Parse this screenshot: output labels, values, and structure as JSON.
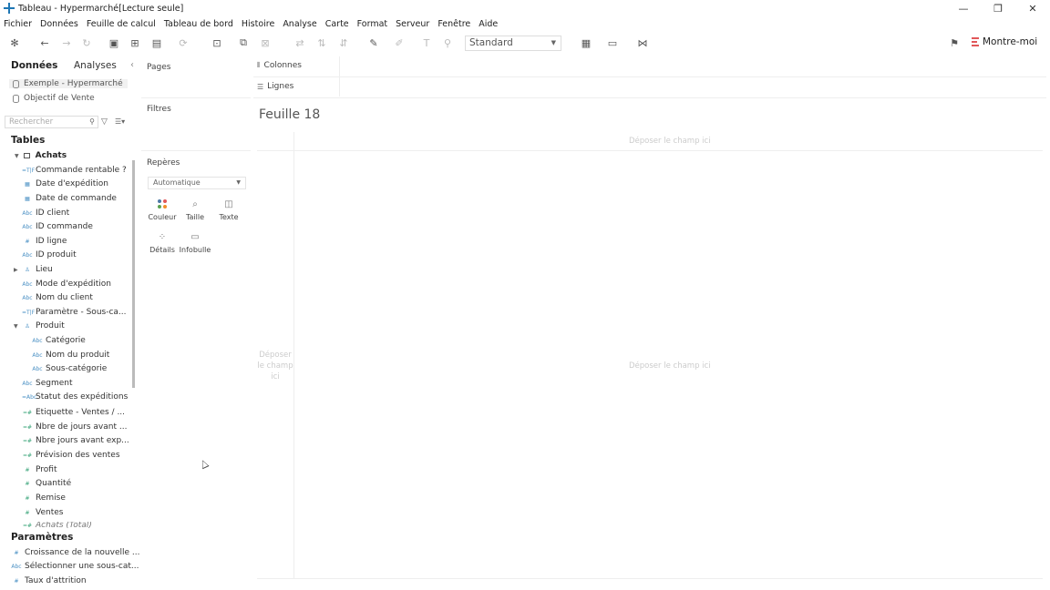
{
  "window": {
    "title": "Tableau - Hypermarché[Lecture seule]"
  },
  "menu": [
    "Fichier",
    "Données",
    "Feuille de calcul",
    "Tableau de bord",
    "Histoire",
    "Analyse",
    "Carte",
    "Format",
    "Serveur",
    "Fenêtre",
    "Aide"
  ],
  "toolbar": {
    "fit_select": "Standard",
    "show_me_label": "Montre-moi"
  },
  "data_pane": {
    "tab_data": "Données",
    "tab_analysis": "Analyses",
    "datasources": [
      "Exemple - Hypermarché",
      "Objectif de Vente"
    ],
    "search_placeholder": "Rechercher",
    "tables_title": "Tables",
    "table_name": "Achats",
    "fields": [
      {
        "icon": "=T|F",
        "label": "Commande rentable ?"
      },
      {
        "icon": "cal",
        "label": "Date d'expédition"
      },
      {
        "icon": "cal",
        "label": "Date de commande"
      },
      {
        "icon": "Abc",
        "label": "ID client"
      },
      {
        "icon": "Abc",
        "label": "ID commande"
      },
      {
        "icon": "#",
        "label": "ID ligne"
      },
      {
        "icon": "Abc",
        "label": "ID produit"
      },
      {
        "icon": "hier",
        "label": "Lieu"
      },
      {
        "icon": "Abc",
        "label": "Mode d'expédition"
      },
      {
        "icon": "Abc",
        "label": "Nom du client"
      },
      {
        "icon": "=T|F",
        "label": "Paramètre - Sous-ca..."
      },
      {
        "icon": "hier",
        "label": "Produit"
      },
      {
        "icon": "Abc",
        "label": "Catégorie"
      },
      {
        "icon": "Abc",
        "label": "Nom du produit"
      },
      {
        "icon": "Abc",
        "label": "Sous-catégorie"
      },
      {
        "icon": "Abc",
        "label": "Segment"
      },
      {
        "icon": "=Abc",
        "label": "Statut des expéditions"
      },
      {
        "icon": "=#",
        "label": "Etiquette - Ventes / ..."
      },
      {
        "icon": "=#",
        "label": "Nbre de jours avant ..."
      },
      {
        "icon": "=#",
        "label": "Nbre jours avant exp..."
      },
      {
        "icon": "=#",
        "label": "Prévision des ventes"
      },
      {
        "icon": "#",
        "label": "Profit"
      },
      {
        "icon": "#",
        "label": "Quantité"
      },
      {
        "icon": "#",
        "label": "Remise"
      },
      {
        "icon": "#",
        "label": "Ventes"
      },
      {
        "icon": "=#",
        "label": "Achats (Total)"
      }
    ],
    "params_title": "Paramètres",
    "params": [
      {
        "icon": "#",
        "label": "Croissance de la nouvelle ..."
      },
      {
        "icon": "Abc",
        "label": "Sélectionner une sous-cat..."
      },
      {
        "icon": "#",
        "label": "Taux d'attrition"
      }
    ]
  },
  "cards": {
    "pages": "Pages",
    "filters": "Filtres",
    "marks": "Repères",
    "marks_type": "Automatique",
    "mark_buttons": {
      "color": "Couleur",
      "size": "Taille",
      "text": "Texte",
      "detail": "Détails",
      "tooltip": "Infobulle"
    }
  },
  "shelves": {
    "columns": "Colonnes",
    "rows": "Lignes"
  },
  "canvas": {
    "sheet_title": "Feuille 18",
    "drop_top": "Déposer le champ ici",
    "drop_center": "Déposer le champ ici",
    "drop_left": "Déposer le champ ici"
  },
  "colors": {
    "accent": "#1f77b4",
    "abc_icon": "#4a90c4",
    "measure_icon": "#3aa57a"
  }
}
